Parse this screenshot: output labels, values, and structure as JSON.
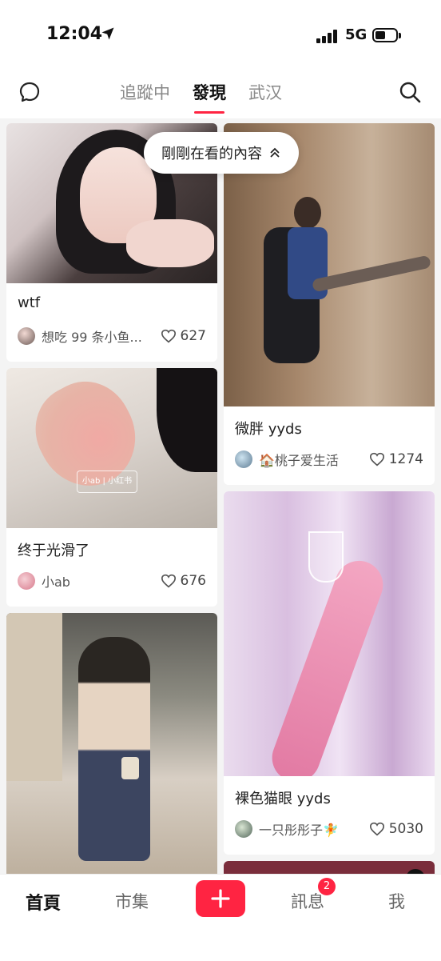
{
  "status": {
    "time": "12:04",
    "network": "5G"
  },
  "nav": {
    "tabs": [
      {
        "label": "追蹤中"
      },
      {
        "label": "發現"
      },
      {
        "label": "武汉"
      }
    ]
  },
  "floating": {
    "label": "剛剛在看的內容"
  },
  "feed": {
    "left": [
      {
        "title": "wtf",
        "author": "想吃 99 条小鱼...",
        "likes": "627"
      },
      {
        "title": "终于光滑了",
        "author": "小ab",
        "likes": "676",
        "watermark": "小ab | 小红书"
      }
    ],
    "right": [
      {
        "title": "微胖 yyds",
        "author": "🏠桃子爱生活",
        "likes": "1274"
      },
      {
        "title": "裸色猫眼 yyds",
        "author": "一只彤彤子🧚",
        "likes": "5030"
      }
    ]
  },
  "bottom": {
    "home": "首頁",
    "market": "市集",
    "messages": "訊息",
    "me": "我",
    "badge": "2"
  },
  "colors": {
    "accent": "#ff2442"
  },
  "icons": [
    "location-arrow-icon",
    "chat-bubble-icon",
    "search-icon",
    "heart-icon",
    "plus-icon",
    "chevron-up-icon",
    "play-icon"
  ]
}
